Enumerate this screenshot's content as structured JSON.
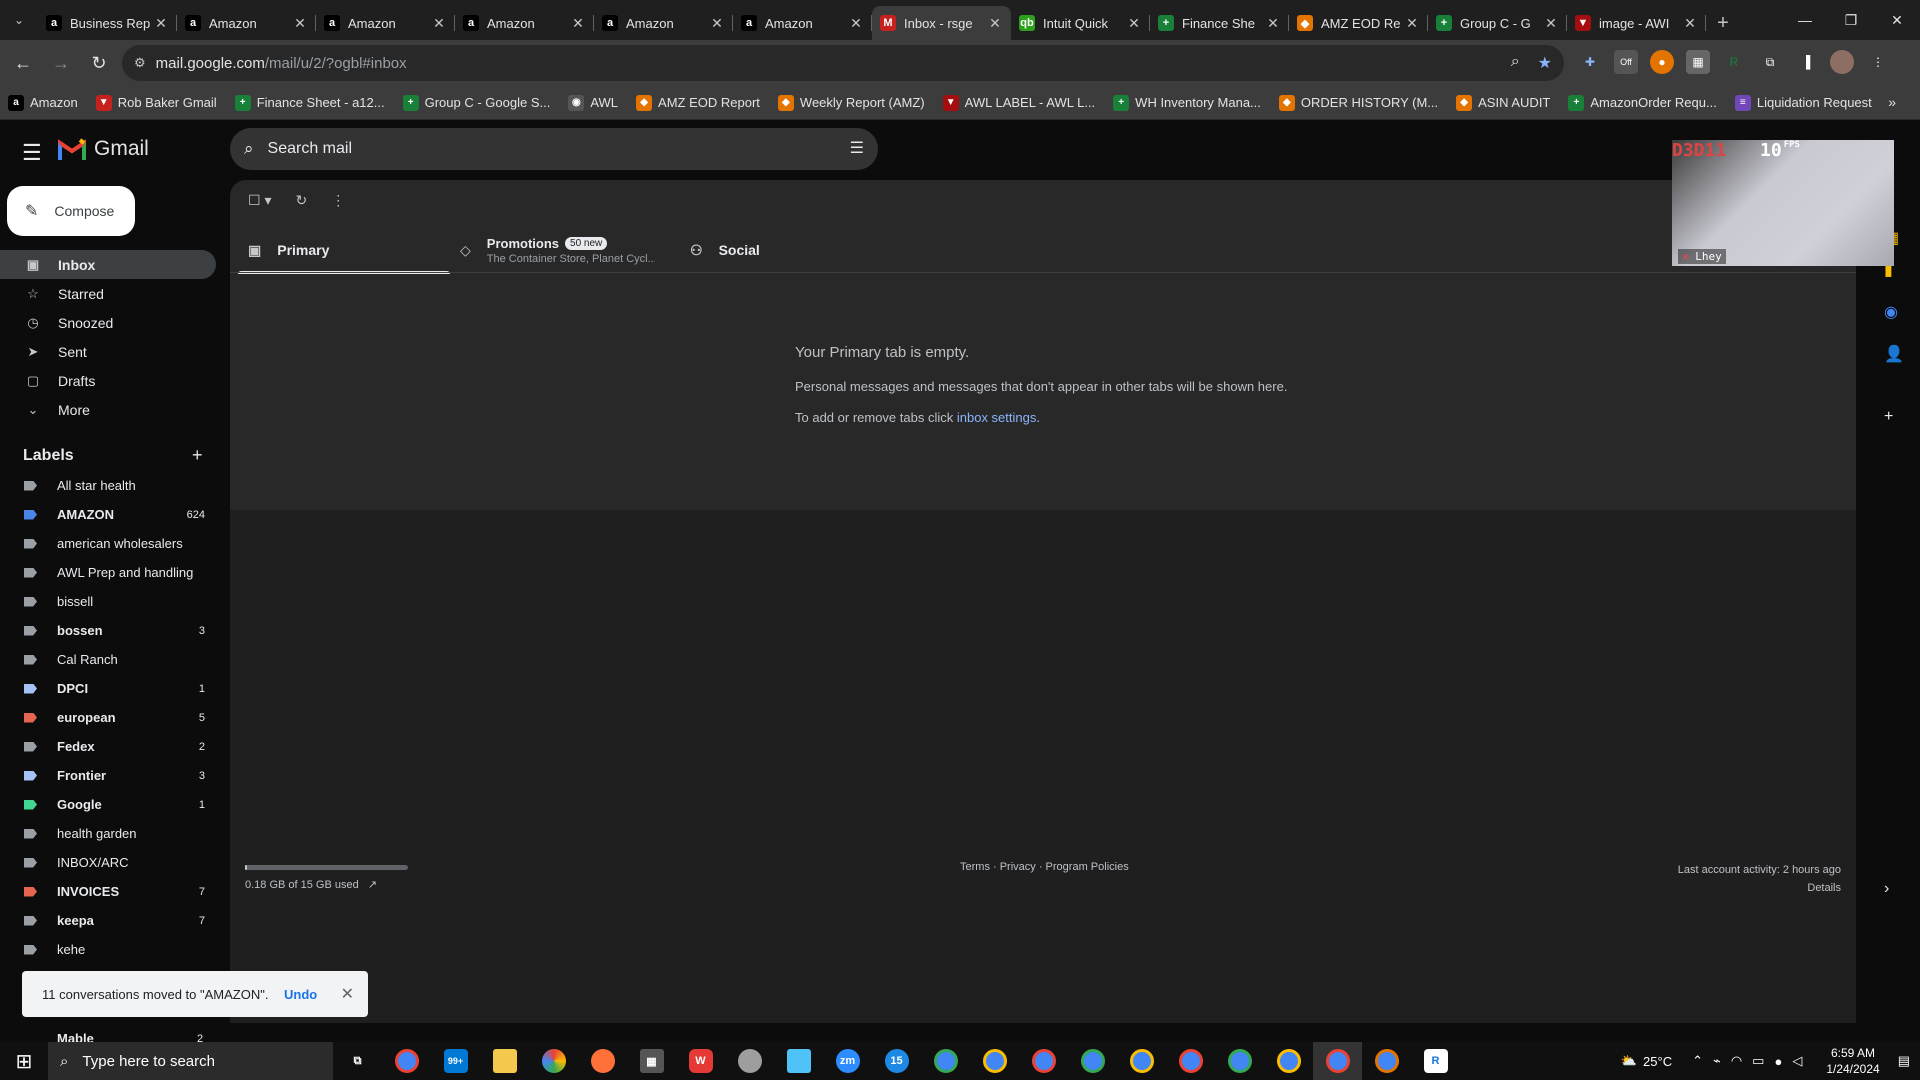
{
  "browser": {
    "tabs": [
      {
        "title": "Business Rep",
        "fav": "a",
        "fav_bg": "#000"
      },
      {
        "title": "Amazon",
        "fav": "a",
        "fav_bg": "#000"
      },
      {
        "title": "Amazon",
        "fav": "a",
        "fav_bg": "#000"
      },
      {
        "title": "Amazon",
        "fav": "a",
        "fav_bg": "#000"
      },
      {
        "title": "Amazon",
        "fav": "a",
        "fav_bg": "#000"
      },
      {
        "title": "Amazon",
        "fav": "a",
        "fav_bg": "#000"
      },
      {
        "title": "Inbox - rsge",
        "fav": "M",
        "fav_bg": "#c5221f",
        "active": true
      },
      {
        "title": "Intuit Quick",
        "fav": "qb",
        "fav_bg": "#2ca01c"
      },
      {
        "title": "Finance She",
        "fav": "+",
        "fav_bg": "#188038"
      },
      {
        "title": "AMZ EOD Re",
        "fav": "◆",
        "fav_bg": "#e37400"
      },
      {
        "title": "Group C - G",
        "fav": "+",
        "fav_bg": "#188038"
      },
      {
        "title": "image - AWI",
        "fav": "▼",
        "fav_bg": "#a50e0e"
      }
    ],
    "url_host": "mail.google.com",
    "url_path": "/mail/u/2/?ogbl#inbox",
    "bookmarks": [
      {
        "label": "Amazon",
        "icon": "a",
        "color": "#000"
      },
      {
        "label": "Rob Baker Gmail",
        "icon": "▼",
        "color": "#c5221f"
      },
      {
        "label": "Finance Sheet - a12...",
        "icon": "+",
        "color": "#188038"
      },
      {
        "label": "Group C - Google S...",
        "icon": "+",
        "color": "#188038"
      },
      {
        "label": "AWL",
        "icon": "◉",
        "color": "#555"
      },
      {
        "label": "AMZ EOD Report",
        "icon": "◆",
        "color": "#e37400"
      },
      {
        "label": "Weekly Report (AMZ)",
        "icon": "◆",
        "color": "#e37400"
      },
      {
        "label": "AWL LABEL - AWL L...",
        "icon": "▼",
        "color": "#a50e0e"
      },
      {
        "label": "WH Inventory Mana...",
        "icon": "+",
        "color": "#188038"
      },
      {
        "label": "ORDER HISTORY (M...",
        "icon": "◆",
        "color": "#e37400"
      },
      {
        "label": "ASIN AUDIT",
        "icon": "◆",
        "color": "#e37400"
      },
      {
        "label": "AmazonOrder Requ...",
        "icon": "+",
        "color": "#188038"
      },
      {
        "label": "Liquidation Request",
        "icon": "≡",
        "color": "#7248b9"
      }
    ]
  },
  "gmail": {
    "app_name": "Gmail",
    "search_placeholder": "Search mail",
    "compose_label": "Compose",
    "nav": [
      {
        "label": "Inbox",
        "icon": "▣",
        "active": true
      },
      {
        "label": "Starred",
        "icon": "☆"
      },
      {
        "label": "Snoozed",
        "icon": "◷"
      },
      {
        "label": "Sent",
        "icon": "➤"
      },
      {
        "label": "Drafts",
        "icon": "▢"
      },
      {
        "label": "More",
        "icon": "⌄"
      }
    ],
    "labels_title": "Labels",
    "labels": [
      {
        "name": "All star health",
        "color": "#9aa0a6",
        "count": ""
      },
      {
        "name": "AMAZON",
        "color": "#4a86e8",
        "count": "624",
        "bold": true
      },
      {
        "name": "american wholesalers",
        "color": "#9aa0a6",
        "count": ""
      },
      {
        "name": "AWL Prep and handling",
        "color": "#9aa0a6",
        "count": ""
      },
      {
        "name": "bissell",
        "color": "#9aa0a6",
        "count": ""
      },
      {
        "name": "bossen",
        "color": "#9aa0a6",
        "count": "3",
        "bold": true
      },
      {
        "name": "Cal Ranch",
        "color": "#9aa0a6",
        "count": ""
      },
      {
        "name": "DPCI",
        "color": "#a4c2f4",
        "count": "1",
        "bold": true
      },
      {
        "name": "european",
        "color": "#e66550",
        "count": "5",
        "bold": true
      },
      {
        "name": "Fedex",
        "color": "#9aa0a6",
        "count": "2",
        "bold": true
      },
      {
        "name": "Frontier",
        "color": "#a4c2f4",
        "count": "3",
        "bold": true
      },
      {
        "name": "Google",
        "color": "#43d692",
        "count": "1",
        "bold": true
      },
      {
        "name": "health garden",
        "color": "#9aa0a6",
        "count": ""
      },
      {
        "name": "INBOX/ARC",
        "color": "#9aa0a6",
        "count": ""
      },
      {
        "name": "INVOICES",
        "color": "#e66550",
        "count": "7",
        "bold": true
      },
      {
        "name": "keepa",
        "color": "#9aa0a6",
        "count": "7",
        "bold": true
      },
      {
        "name": "kehe",
        "color": "#9aa0a6",
        "count": ""
      }
    ],
    "partial_label": {
      "name": "Mable",
      "count": "2"
    },
    "tabs": {
      "primary": "Primary",
      "promotions": "Promotions",
      "promotions_badge": "50 new",
      "promotions_senders": "The Container Store, Planet Cycl...",
      "social": "Social"
    },
    "empty": {
      "heading": "Your Primary tab is empty.",
      "line1": "Personal messages and messages that don't appear in other tabs will be shown here.",
      "line2_prefix": "To add or remove tabs click ",
      "line2_link": "inbox settings",
      "line2_suffix": "."
    },
    "storage": {
      "used_text": "0.18 GB of 15 GB used",
      "fraction": 0.012
    },
    "footer_links": "Terms · Privacy · Program Policies",
    "last_activity": "Last account activity: 2 hours ago",
    "details": "Details",
    "toast": {
      "message": "11 conversations moved to \"AMAZON\".",
      "undo": "Undo"
    }
  },
  "overlay": {
    "id_text": "D3D11",
    "fps_value": "10",
    "fps_unit": "FPS",
    "user": "Lhey"
  },
  "taskbar": {
    "search_placeholder": "Type here to search",
    "mail_badge": "99+",
    "temperature": "25°C",
    "time": "6:59 AM",
    "date": "1/24/2024"
  }
}
